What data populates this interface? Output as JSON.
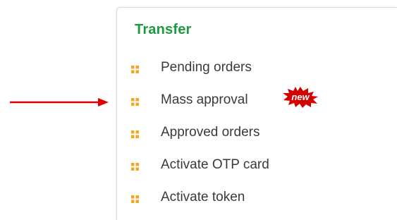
{
  "panel": {
    "title": "Transfer",
    "items": [
      {
        "label": "Pending orders"
      },
      {
        "label": "Mass approval",
        "badge": "new"
      },
      {
        "label": "Approved orders"
      },
      {
        "label": "Activate OTP card"
      },
      {
        "label": "Activate token"
      }
    ]
  },
  "colors": {
    "title": "#1c9a3c",
    "bullet": "#f5a623",
    "arrow": "#e00000",
    "badge": "#d40000",
    "text": "#3a3a3a"
  },
  "icons": {
    "bullet": "grid-bullet-icon",
    "pointer": "arrow-right-icon",
    "badge": "new-starburst-icon"
  }
}
